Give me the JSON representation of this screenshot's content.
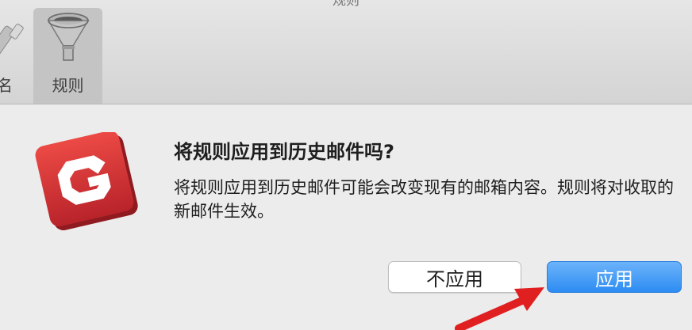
{
  "window": {
    "title": "规则"
  },
  "toolbar": {
    "items": [
      {
        "label": "名",
        "icon": "signature-icon"
      },
      {
        "label": "规则",
        "icon": "funnel-icon",
        "selected": true
      }
    ]
  },
  "dialog": {
    "app_icon": "foxmail-logo-icon",
    "title": "将规则应用到历史邮件吗?",
    "message": "将规则应用到历史邮件可能会改变现有的邮箱内容。规则将对收取的新邮件生效。",
    "buttons": {
      "cancel_label": "不应用",
      "apply_label": "应用"
    }
  },
  "colors": {
    "accent": "#2d8cf2",
    "logo_red": "#d93636",
    "annotation_arrow": "#e02020"
  }
}
